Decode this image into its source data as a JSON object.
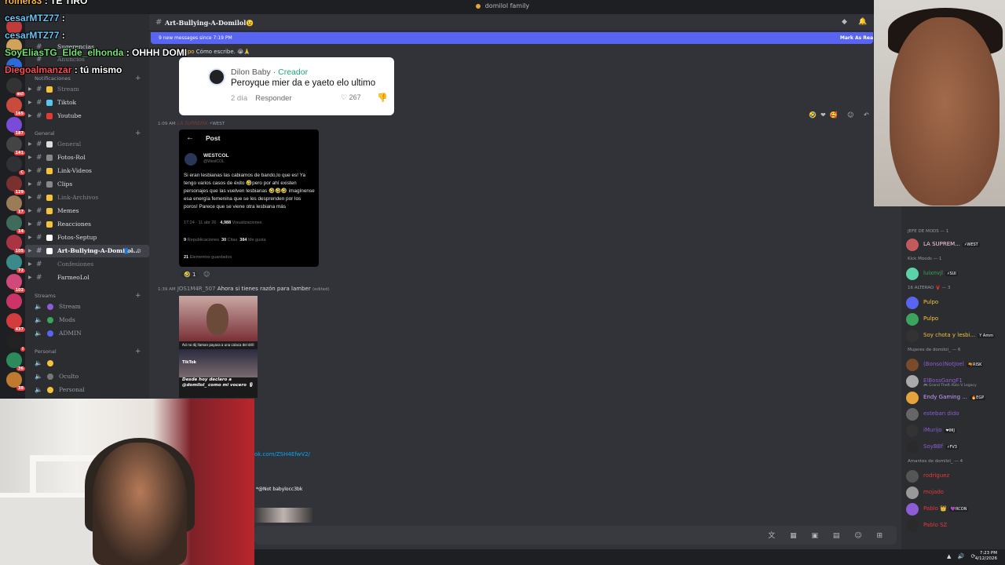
{
  "window": {
    "title": "domilol family"
  },
  "overlay_chat": [
    {
      "user": "rolner83",
      "message": ": TE TIRO",
      "color": "u1"
    },
    {
      "user": "cesarMTZ77",
      "message": ":",
      "color": "u2"
    },
    {
      "user": "cesarMTZ77",
      "message": ":",
      "color": "u2"
    },
    {
      "user": "SoyEliasTG_Elde_elhonda",
      "message": ": OHHH DOMI",
      "color": "u3"
    },
    {
      "user": "Diegoalmanzar",
      "message": ": tú mismo",
      "color": "u4"
    }
  ],
  "servers": [
    {
      "color": "#c23b3b",
      "badge": ""
    },
    {
      "color": "#cfa35a",
      "badge": ""
    },
    {
      "color": "#2d6bd8",
      "badge": ""
    },
    {
      "color": "#333",
      "badge": "ecl"
    },
    {
      "color": "#c84b3c",
      "badge": "165"
    },
    {
      "color": "#7a4ad8",
      "badge": "187"
    },
    {
      "color": "#444",
      "badge": "141"
    },
    {
      "color": "#2f3136",
      "badge": "C"
    },
    {
      "color": "#7b3030",
      "badge": "129"
    },
    {
      "color": "#9a7c57",
      "badge": "17"
    },
    {
      "color": "#3f6b5a",
      "badge": "14"
    },
    {
      "color": "#aa3344",
      "badge": "105"
    },
    {
      "color": "#3a8a8a",
      "badge": "72"
    },
    {
      "color": "#d1487a",
      "badge": "102"
    },
    {
      "color": "#cc3366",
      "badge": ""
    },
    {
      "color": "#d23c3c",
      "badge": "437"
    },
    {
      "color": "#222",
      "badge": "I"
    },
    {
      "color": "#2d8a5a",
      "badge": "36"
    },
    {
      "color": "#c07a30",
      "badge": "38"
    }
  ],
  "sidebar": {
    "top_items": [
      "Sugerencias",
      "Anuncios"
    ],
    "categories": {
      "notifications": "Notificaciones",
      "general": "General",
      "streams": "Streams",
      "personal": "Personal"
    },
    "notification_channels": [
      {
        "name": "Stream",
        "color": "#f5c33b",
        "muted": true
      },
      {
        "name": "Tiktok",
        "color": "#55c6f0",
        "muted": false
      },
      {
        "name": "Youtube",
        "color": "#e53935",
        "muted": false
      }
    ],
    "general_channels": [
      {
        "name": "General",
        "color": "#ddd",
        "muted": true
      },
      {
        "name": "Fotos-Rol",
        "color": "#888",
        "muted": false
      },
      {
        "name": "Link-Videos",
        "color": "#f5c33b",
        "muted": false
      },
      {
        "name": "Clips",
        "color": "#888",
        "muted": false
      },
      {
        "name": "Link-Archivos",
        "color": "#f5c33b",
        "muted": true
      },
      {
        "name": "Memes",
        "color": "#f5c33b",
        "muted": false
      },
      {
        "name": "Reacciones",
        "color": "#f5c33b",
        "muted": false
      },
      {
        "name": "Fotos-Septup",
        "color": "#fff",
        "muted": false
      },
      {
        "name": "Art-Bullying-A-Domilol...",
        "color": "#fff",
        "muted": false,
        "active": true
      },
      {
        "name": "Confesiones",
        "color": "",
        "muted": true
      },
      {
        "name": "FarmeoLol",
        "color": "",
        "muted": false
      }
    ],
    "voice_channels": [
      {
        "name": "Stream",
        "color": "#8e5cd6"
      },
      {
        "name": "Mods",
        "color": "#3ba55d"
      },
      {
        "name": "ADMIN",
        "color": "#5865f2"
      }
    ],
    "personal_channels": [
      {
        "name": "",
        "color": "#f5c33b"
      },
      {
        "name": "Oculto",
        "color": "#777"
      },
      {
        "name": "Personal",
        "color": "#f5c33b"
      }
    ]
  },
  "header": {
    "channel": "Art-Bullying-A-Domilol😉"
  },
  "newbar": {
    "left": "9 new messages since 7:19 PM",
    "right": "Mark As Rea"
  },
  "messages": {
    "first": {
      "author": "pulpo",
      "text": "Cómo escribe. 😭🙏"
    },
    "comment": {
      "name": "Dilon Baby",
      "role": "Creador",
      "text": "Peroyque mier da e yaeto elo ultimo",
      "age": "2 día",
      "reply": "Responder",
      "likes": "267"
    },
    "second": {
      "time": "1:09 AM",
      "author": "LA SUPREMA",
      "tag": "⚡WEST"
    },
    "xpost": {
      "header": "Post",
      "name": "WESTCOL",
      "handle": "@WestCOL",
      "body": "Si eran lesbianas las cabiamos de bando,lo que es! Ya tengo varios casos de éxito 🤣pero por ahí existen personajes que las vuelven lesbianas 🤣🤣🤣 imagínense esa energía femenina que se les desprenden por los poros! Parece que se viene otra lesbiana más",
      "date": "17:24 · 11 abr 26 · ",
      "views": "4,988",
      "views_label": " Visualizaciones",
      "reposts": "9",
      "reposts_label": " Republicaciones",
      "quotes": "30",
      "quotes_label": " Citas",
      "likes": "384",
      "likes_label": " Me gusta",
      "saved": "21",
      "saved_label": " Elementos guardados"
    },
    "reaction": "🤣 1",
    "third": {
      "time": "1:39 AM",
      "author": "JOS1M4R_507",
      "text": "Ahora si tienes razón para lamber",
      "edited": "(edited)"
    },
    "tiktok": {
      "caption_top": "Así no dij llaman payasa a una calaca del drill",
      "logo": "TikTok",
      "caption": "Desde hoy declaro a @domilol_ como mi vocero 🎙"
    },
    "link": "ok.com/ZSH4EfwV2/",
    "mention": "*@Not babylocc3bk"
  },
  "members": {
    "groups": [
      {
        "label": "JEFE DE MODS — 1",
        "items": [
          {
            "name": "LA SUPREM...",
            "tag": "⚡WEST",
            "color": "#ffd1dc",
            "av": "#c25a5a"
          }
        ]
      },
      {
        "label": "Kick Moods — 1",
        "items": [
          {
            "name": "luixnvjl",
            "tag": "⚡SUI",
            "color": "#3ba55d",
            "av": "#5bd2a8"
          }
        ]
      },
      {
        "label": "16 ALTERAO 🦞 — 3",
        "items": [
          {
            "name": "Pulpo",
            "tag": "",
            "color": "#f5c33b",
            "av": "#5865f2"
          },
          {
            "name": "Pulpo",
            "tag": "",
            "color": "#f5c33b",
            "av": "#3ba55d"
          },
          {
            "name": "Soy chota y lesbi...",
            "tag": "Y Amm",
            "color": "#f5c33b",
            "av": "#333"
          }
        ]
      },
      {
        "label": "Mujeres de domilol_ — 6",
        "items": [
          {
            "name": "(Bonso)NotJoel",
            "tag": "🔫RISK",
            "color": "#8e5cd6",
            "av": "#7a4a2a"
          },
          {
            "name": "ElBossGangF1",
            "tag": "",
            "color": "#8e5cd6",
            "av": "#aaa"
          },
          {
            "name": "Endy Gaming ...",
            "tag": "🔥EGP",
            "color": "#c9a0ff",
            "av": "#e6a23c"
          },
          {
            "name": "esteban dido",
            "tag": "",
            "color": "#8e5cd6",
            "av": "#666"
          },
          {
            "name": "iMurijo",
            "tag": "❤IMJ",
            "color": "#8e5cd6",
            "av": "#333"
          },
          {
            "name": "SoyBBf",
            "tag": "⚡FV3",
            "color": "#8e5cd6",
            "av": "#2a2a2a"
          }
        ]
      },
      {
        "label": "Amantes de domilol_ — 4",
        "items": [
          {
            "name": "rodriguez",
            "tag": "",
            "color": "#e53935",
            "av": "#555"
          },
          {
            "name": "mojado",
            "tag": "",
            "color": "#e53935",
            "av": "#999"
          },
          {
            "name": "Pablo 👑",
            "tag": "💜RCON",
            "color": "#e53935",
            "av": "#8e5cd6"
          },
          {
            "name": "Pablo SZ",
            "tag": "",
            "color": "#e53935",
            "av": "#2a2a2a"
          }
        ]
      }
    ],
    "sub_elboss": "🎮 Grand Theft Auto V Legacy"
  },
  "taskbar": {
    "time": "7:23 PM",
    "date": "4/12/2026"
  }
}
